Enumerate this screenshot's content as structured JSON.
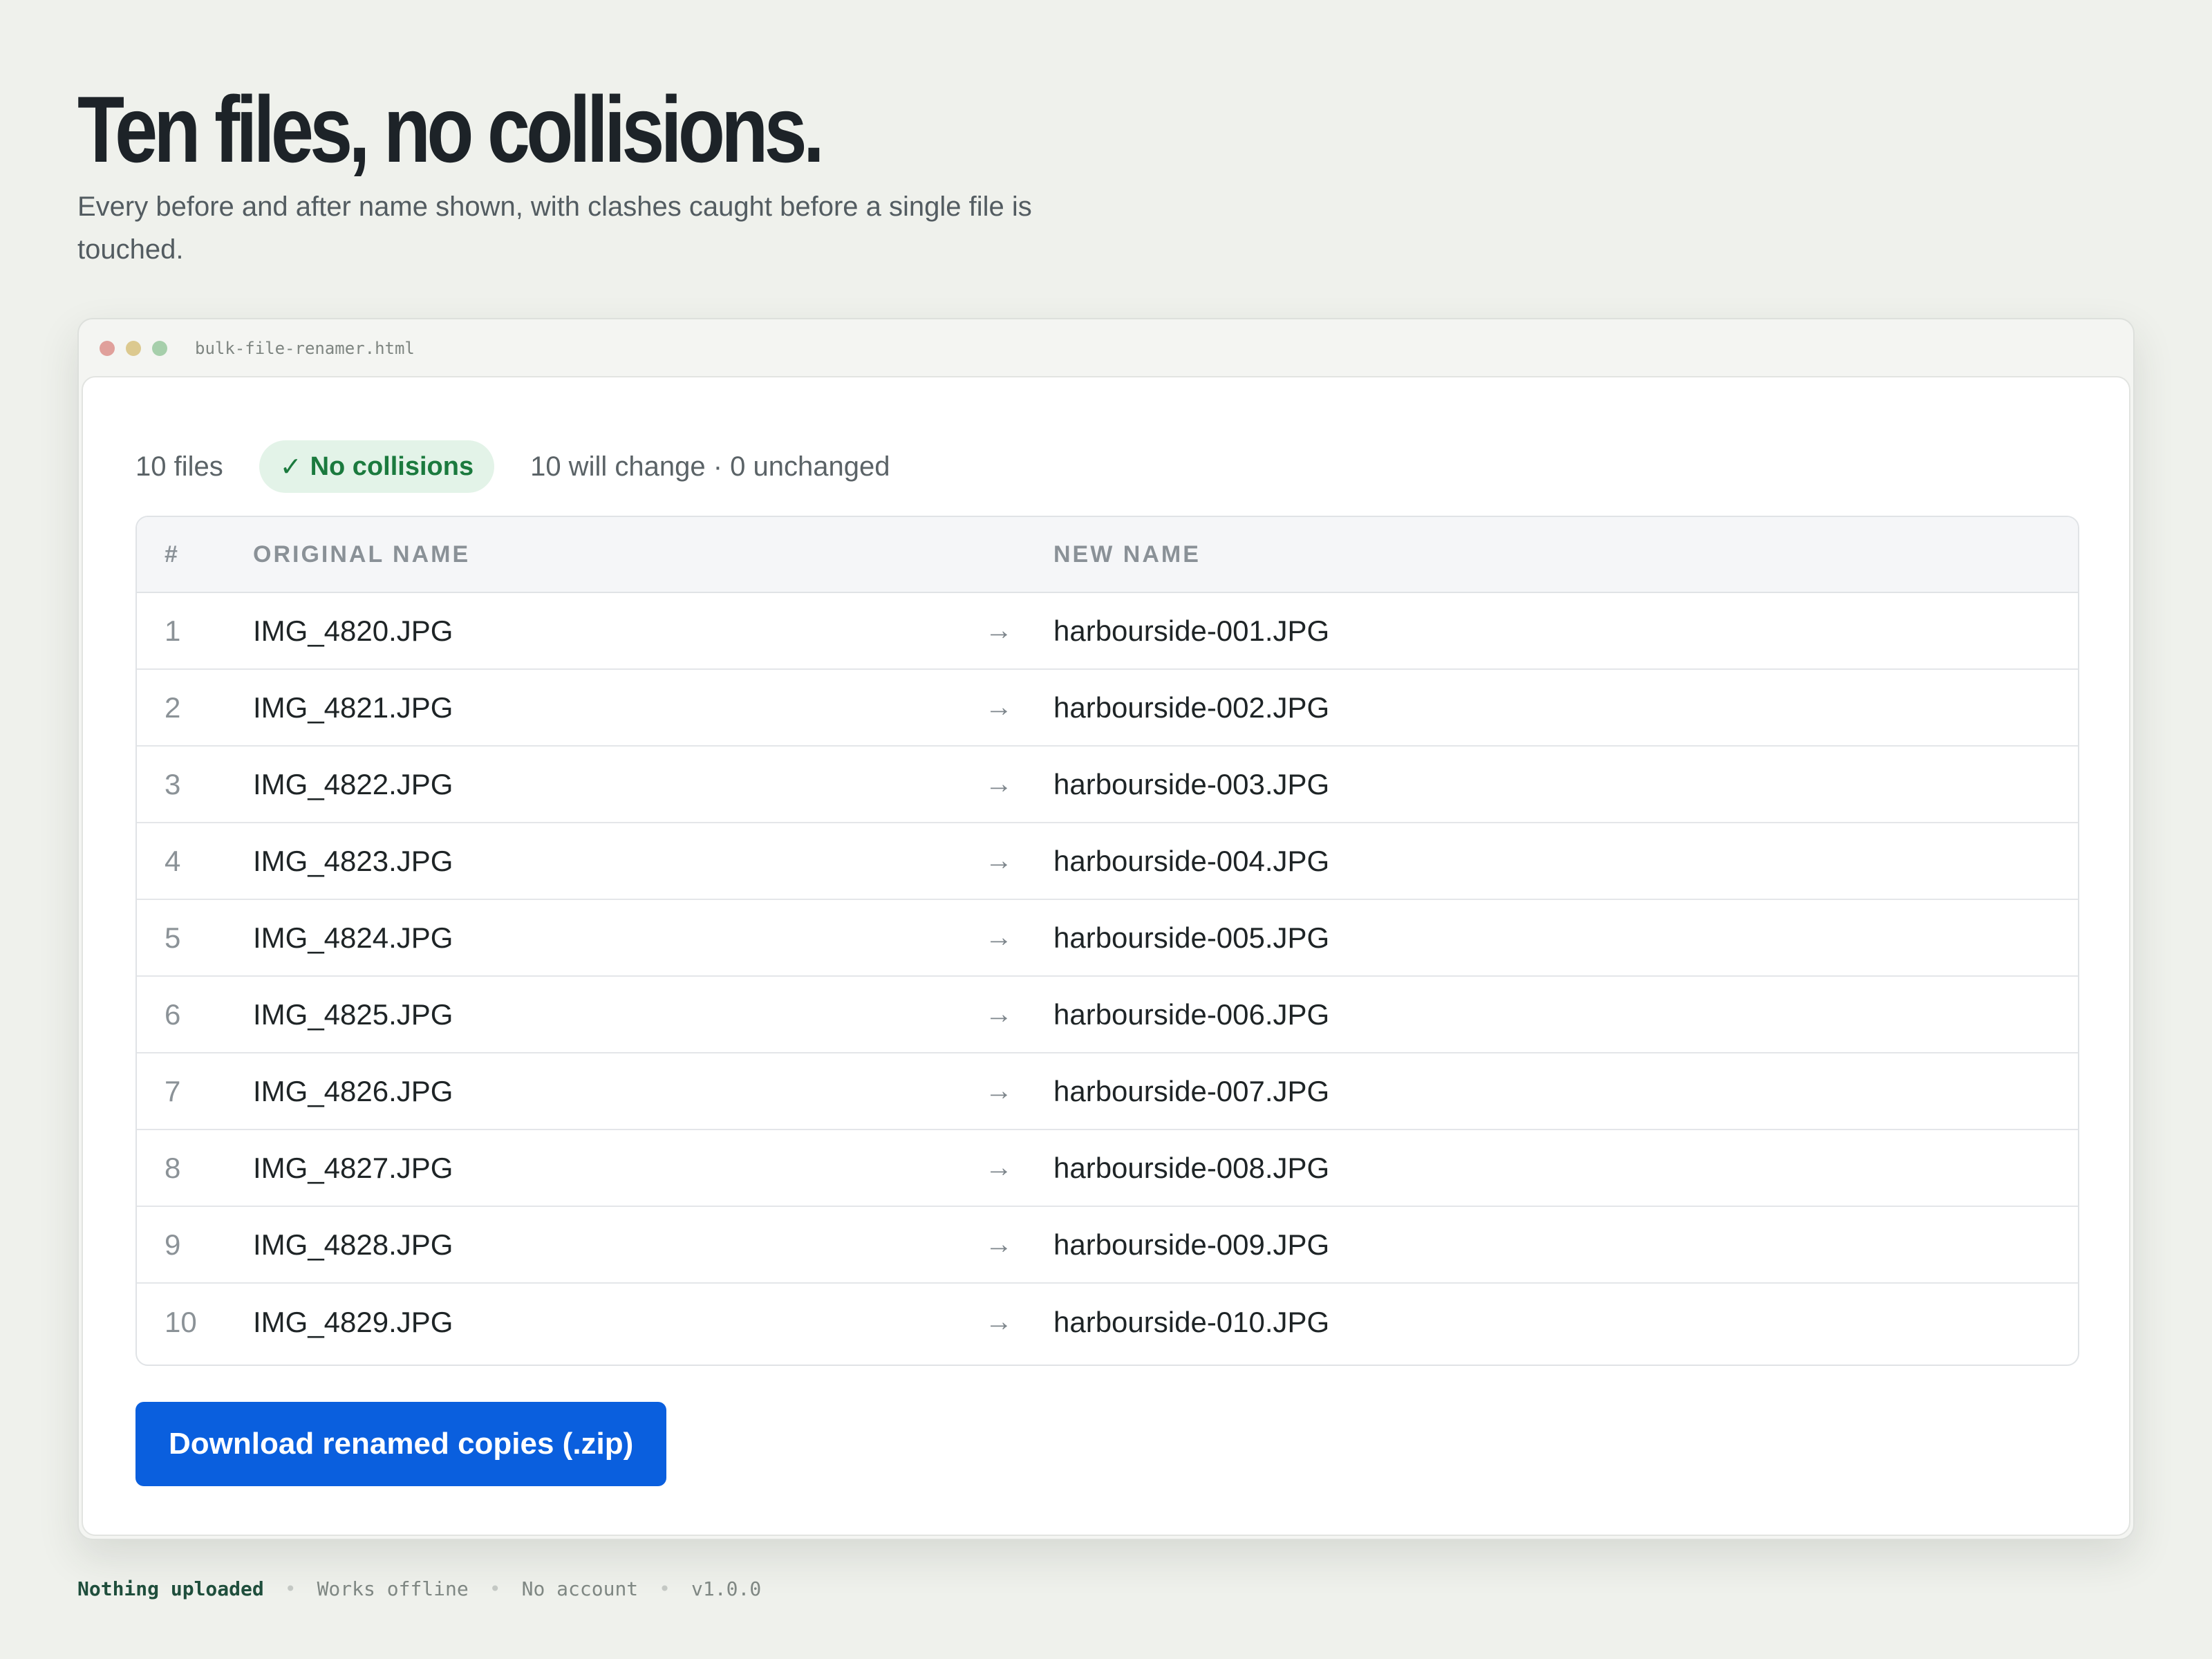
{
  "hero": {
    "title": "Ten files, no collisions.",
    "subtitle": "Every before and after name shown, with clashes caught before a single file is touched."
  },
  "window": {
    "title": "bulk-file-renamer.html",
    "controls": [
      "close",
      "minimize",
      "maximize"
    ]
  },
  "status": {
    "file_count": "10 files",
    "badge_icon": "✓",
    "badge_label": "No collisions",
    "summary": "10 will change · 0 unchanged"
  },
  "table": {
    "headers": {
      "number": "#",
      "original": "ORIGINAL NAME",
      "new": "NEW NAME"
    },
    "arrow": "→",
    "rows": [
      {
        "num": "1",
        "original": "IMG_4820.JPG",
        "new": "harbourside-001.JPG"
      },
      {
        "num": "2",
        "original": "IMG_4821.JPG",
        "new": "harbourside-002.JPG"
      },
      {
        "num": "3",
        "original": "IMG_4822.JPG",
        "new": "harbourside-003.JPG"
      },
      {
        "num": "4",
        "original": "IMG_4823.JPG",
        "new": "harbourside-004.JPG"
      },
      {
        "num": "5",
        "original": "IMG_4824.JPG",
        "new": "harbourside-005.JPG"
      },
      {
        "num": "6",
        "original": "IMG_4825.JPG",
        "new": "harbourside-006.JPG"
      },
      {
        "num": "7",
        "original": "IMG_4826.JPG",
        "new": "harbourside-007.JPG"
      },
      {
        "num": "8",
        "original": "IMG_4827.JPG",
        "new": "harbourside-008.JPG"
      },
      {
        "num": "9",
        "original": "IMG_4828.JPG",
        "new": "harbourside-009.JPG"
      },
      {
        "num": "10",
        "original": "IMG_4829.JPG",
        "new": "harbourside-010.JPG"
      }
    ]
  },
  "actions": {
    "download_label": "Download renamed copies (.zip)"
  },
  "footer": {
    "separator": "•",
    "items": [
      "Nothing uploaded",
      "Works offline",
      "No account",
      "v1.0.0"
    ]
  },
  "colors": {
    "page_background": "#eff1ec",
    "primary_button": "#0a5fde",
    "badge_background": "#e3f3e8",
    "badge_text": "#1b7a3e",
    "footer_highlight": "#1f4e3c",
    "dot_red": "#e0a09b",
    "dot_yellow": "#dcc98f",
    "dot_green": "#a6cfab"
  }
}
